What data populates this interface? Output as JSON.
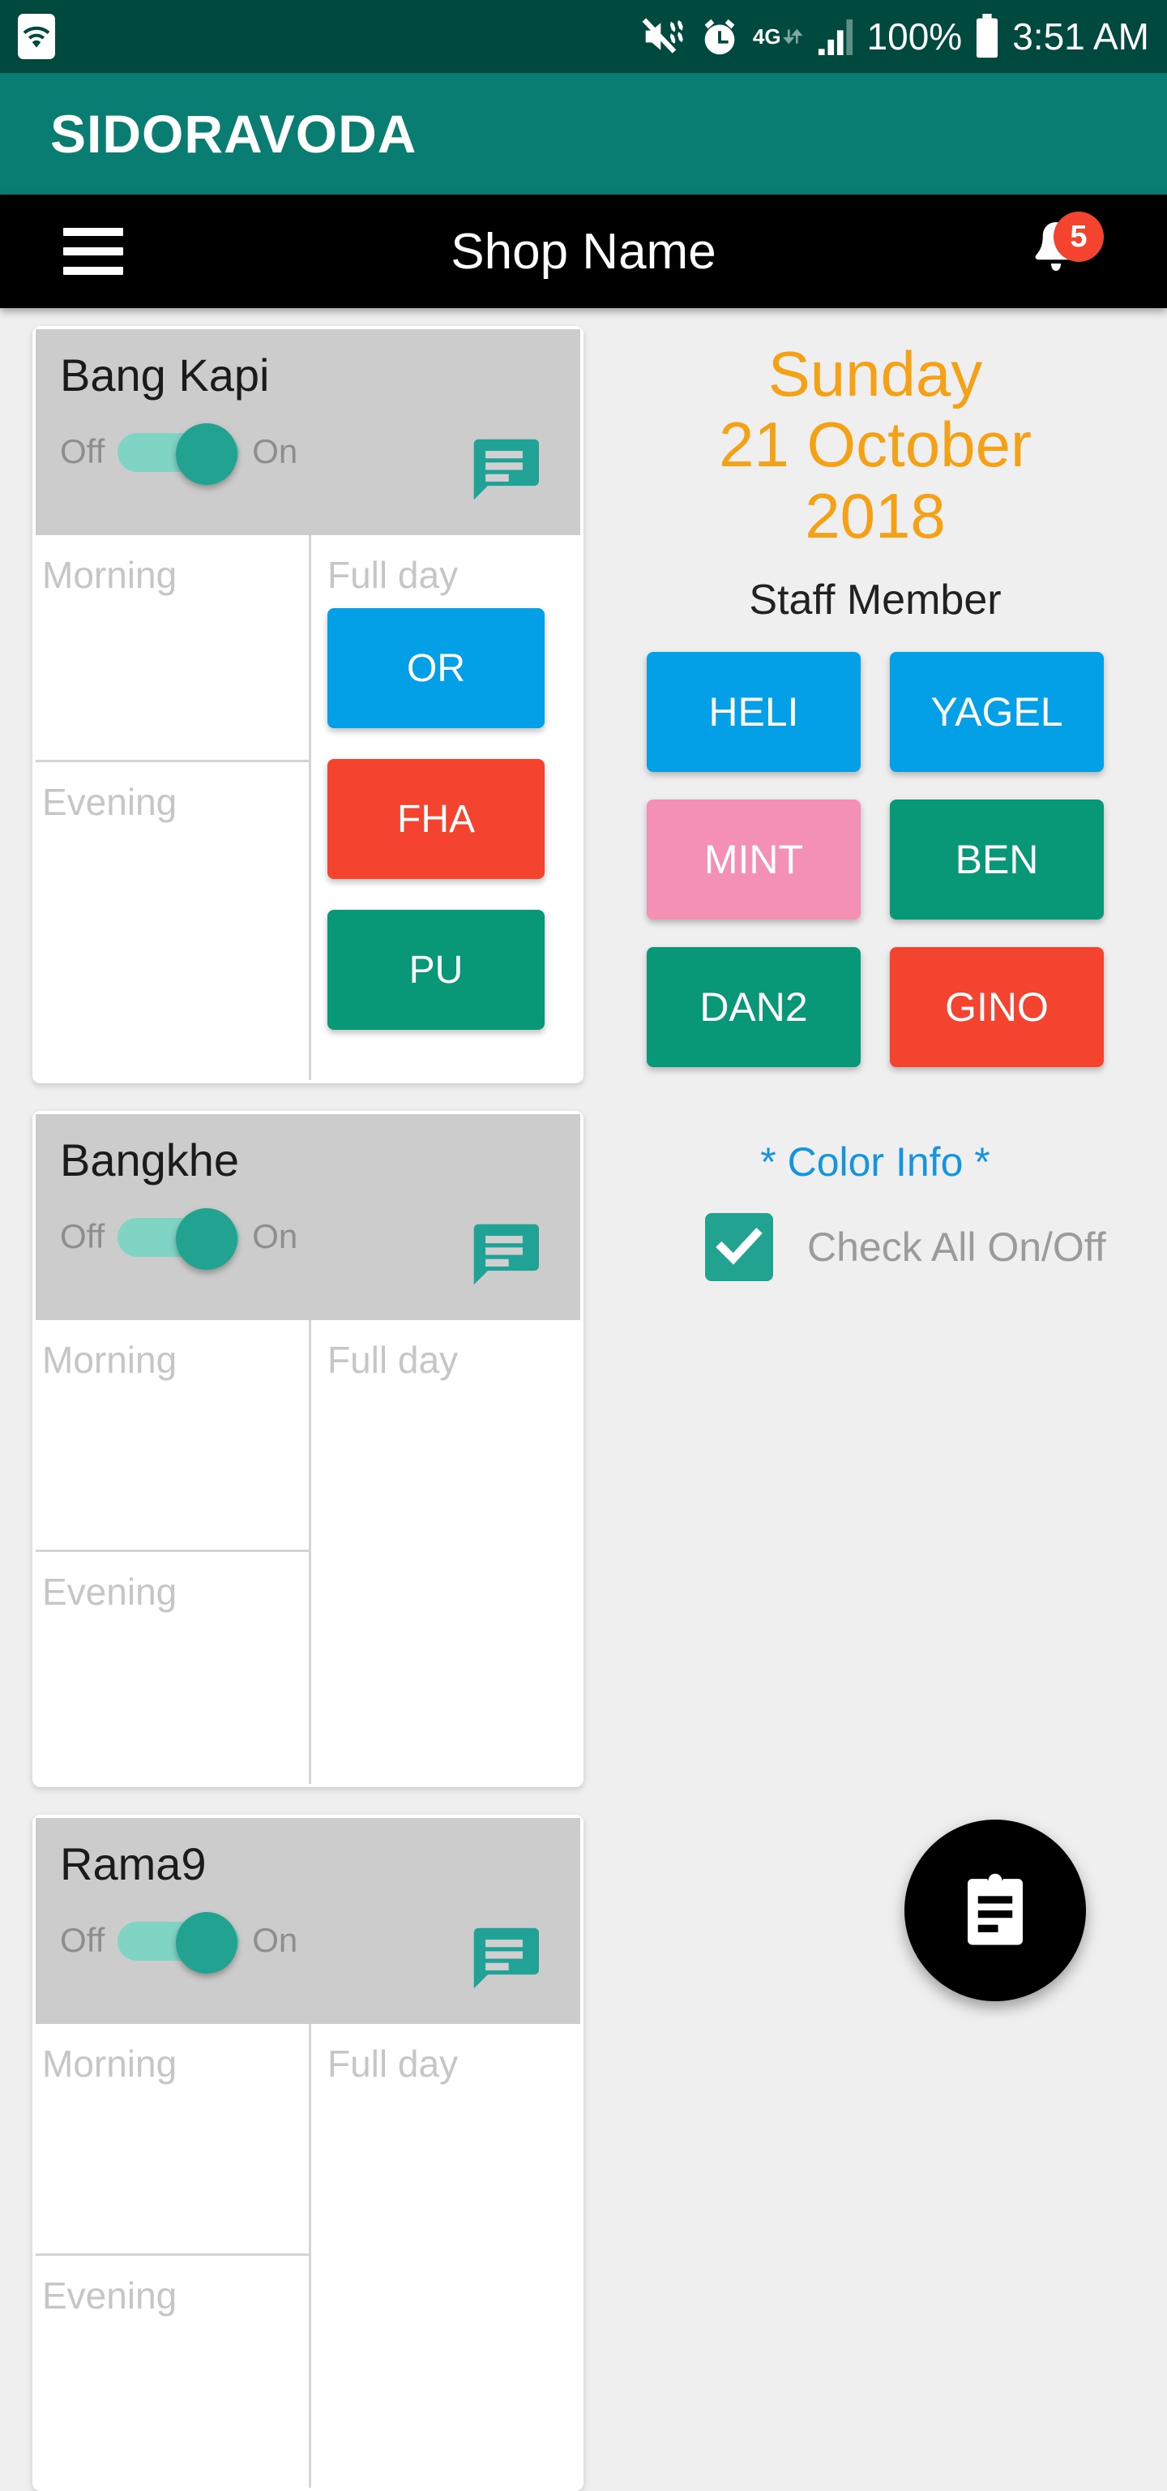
{
  "status_bar": {
    "icons": [
      "wifi-icon",
      "mute-vibrate-icon",
      "alarm-clock-icon",
      "4g-data-icon",
      "signal-bars-icon",
      "battery-icon"
    ],
    "network_label": "4G",
    "battery_percent": "100%",
    "time": "3:51 AM"
  },
  "brand_bar": {
    "title": "SIDORAVODA"
  },
  "toolbar": {
    "menu_icon": "hamburger-menu-icon",
    "title": "Shop Name",
    "notification_icon": "bell-icon",
    "notification_count": "5"
  },
  "shops": [
    {
      "name": "Bang Kapi",
      "toggle_off_label": "Off",
      "toggle_on_label": "On",
      "toggle_state": "on",
      "chat_icon": "message-bubble-icon",
      "slots": [
        {
          "label": "Morning",
          "chips": []
        },
        {
          "label": "Evening",
          "chips": []
        }
      ],
      "fullday_label": "Full day",
      "fullday_chips": [
        {
          "label": "OR",
          "color": "#03A0E8"
        },
        {
          "label": "FHA",
          "color": "#F4432F"
        },
        {
          "label": "PU",
          "color": "#089878"
        }
      ]
    },
    {
      "name": "Bangkhe",
      "toggle_off_label": "Off",
      "toggle_on_label": "On",
      "toggle_state": "on",
      "chat_icon": "message-bubble-icon",
      "slots": [
        {
          "label": "Morning",
          "chips": []
        },
        {
          "label": "Evening",
          "chips": []
        }
      ],
      "fullday_label": "Full day",
      "fullday_chips": []
    },
    {
      "name": "Rama9",
      "toggle_off_label": "Off",
      "toggle_on_label": "On",
      "toggle_state": "on",
      "chat_icon": "message-bubble-icon",
      "slots": [
        {
          "label": "Morning",
          "chips": []
        },
        {
          "label": "Evening",
          "chips": []
        }
      ],
      "fullday_label": "Full day",
      "fullday_chips": []
    }
  ],
  "date_panel": {
    "weekday": "Sunday",
    "day_month": "21 October",
    "year": "2018",
    "color": "#F5A116"
  },
  "staff_section": {
    "heading": "Staff Member",
    "members": [
      {
        "name": "HELI",
        "color": "#03A0E8"
      },
      {
        "name": "YAGEL",
        "color": "#03A0E8"
      },
      {
        "name": "MINT",
        "color": "#F490B4"
      },
      {
        "name": "BEN",
        "color": "#089878"
      },
      {
        "name": "DAN2",
        "color": "#089878"
      },
      {
        "name": "GINO",
        "color": "#F4432F"
      }
    ]
  },
  "color_info": {
    "label": "* Color Info *",
    "color": "#1594E0"
  },
  "check_all": {
    "label": "Check All On/Off",
    "checked": true,
    "check_color": "#22A392"
  },
  "fab": {
    "icon": "clipboard-list-icon"
  }
}
